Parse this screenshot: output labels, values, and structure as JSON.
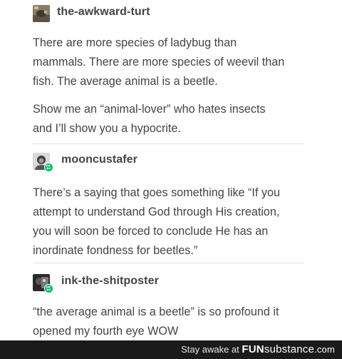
{
  "posts": [
    {
      "username": "the-awkward-turt",
      "paragraphs": [
        [
          "There are more species of ladybug than",
          "mammals. There are more species of weevil than",
          "fish. The average animal is a beetle."
        ],
        [
          "Show me an “animal-lover” who hates insects",
          "and I’ll show you a hypocrite."
        ]
      ]
    },
    {
      "username": "mooncustafer",
      "paragraphs": [
        [
          "There’s a saying that goes something like “If you",
          "attempt to understand God through His creation,",
          "you will soon be forced to conclude He has an",
          "inordinate fondness for beetles.”"
        ]
      ]
    },
    {
      "username": "ink-the-shitposter",
      "paragraphs": [
        [
          "“the average animal is a beetle” is so profound it",
          "opened my fourth eye WOW"
        ]
      ]
    }
  ],
  "watermark": {
    "prefix": "Stay awake at",
    "brand_fun": "FUN",
    "brand_substance": "substance",
    "brand_tld": ".com"
  },
  "colors": {
    "text": "#444444",
    "reblog_badge": "#00b865",
    "footer_bg": "#1a1a1a"
  },
  "icons": [
    "avatar-turtle",
    "avatar-person",
    "avatar-dark",
    "reblog-icon"
  ]
}
